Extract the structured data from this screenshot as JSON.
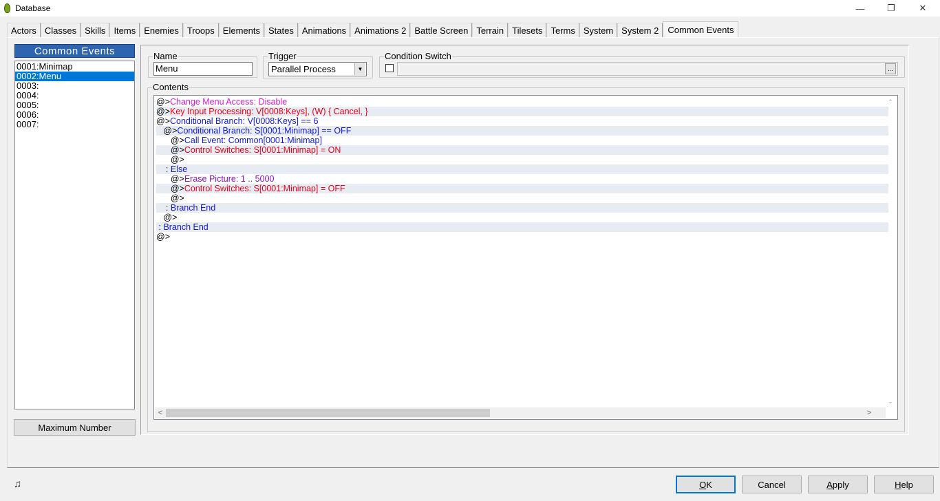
{
  "window": {
    "title": "Database",
    "icons": {
      "app": "egg-icon",
      "minimize": "minimize-icon",
      "restore": "restore-icon",
      "close": "close-icon"
    },
    "minimize_glyph": "—",
    "restore_glyph": "❐",
    "close_glyph": "✕"
  },
  "tabs": [
    {
      "label": "Actors"
    },
    {
      "label": "Classes"
    },
    {
      "label": "Skills"
    },
    {
      "label": "Items"
    },
    {
      "label": "Enemies"
    },
    {
      "label": "Troops"
    },
    {
      "label": "Elements"
    },
    {
      "label": "States"
    },
    {
      "label": "Animations"
    },
    {
      "label": "Animations 2"
    },
    {
      "label": "Battle Screen"
    },
    {
      "label": "Terrain"
    },
    {
      "label": "Tilesets"
    },
    {
      "label": "Terms"
    },
    {
      "label": "System"
    },
    {
      "label": "System 2"
    },
    {
      "label": "Common Events",
      "active": true
    }
  ],
  "sidebar": {
    "header": "Common Events",
    "items": [
      {
        "label": "0001:Minimap"
      },
      {
        "label": "0002:Menu",
        "selected": true
      },
      {
        "label": "0003:"
      },
      {
        "label": "0004:"
      },
      {
        "label": "0005:"
      },
      {
        "label": "0006:"
      },
      {
        "label": "0007:"
      }
    ],
    "max_button": "Maximum Number"
  },
  "form": {
    "name_label": "Name",
    "name_value": "Menu",
    "trigger_label": "Trigger",
    "trigger_value": "Parallel Process",
    "condition_label": "Condition Switch",
    "condition_checked": false,
    "condition_value": "",
    "condition_button": "...",
    "contents_label": "Contents"
  },
  "contents": [
    {
      "indent": "",
      "prefix": "@>",
      "text": "Change Menu Access: Disable",
      "color": "#d81bd8"
    },
    {
      "indent": "",
      "prefix": "@>",
      "text": "Key Input Processing: V[0008:Keys], (W) { Cancel, }",
      "color": "#e8001a"
    },
    {
      "indent": "",
      "prefix": "@>",
      "text": "Conditional Branch: V[0008:Keys] == 6",
      "color": "#1318e0"
    },
    {
      "indent": "   ",
      "prefix": "@>",
      "text": "Conditional Branch: S[0001:Minimap] == OFF",
      "color": "#1318e0"
    },
    {
      "indent": "      ",
      "prefix": "@>",
      "text": "Call Event: Common[0001:Minimap]",
      "color": "#1318e0"
    },
    {
      "indent": "      ",
      "prefix": "@>",
      "text": "Control Switches: S[0001:Minimap] = ON",
      "color": "#e8001a"
    },
    {
      "indent": "      ",
      "prefix": "@>",
      "text": "",
      "color": "#000000"
    },
    {
      "indent": "    ",
      "prefix": ": ",
      "text": "Else",
      "color": "#1318e0"
    },
    {
      "indent": "      ",
      "prefix": "@>",
      "text": "Erase Picture: 1 .. 5000",
      "color": "#8a0fb8"
    },
    {
      "indent": "      ",
      "prefix": "@>",
      "text": "Control Switches: S[0001:Minimap] = OFF",
      "color": "#e8001a"
    },
    {
      "indent": "      ",
      "prefix": "@>",
      "text": "",
      "color": "#000000"
    },
    {
      "indent": "    ",
      "prefix": ": ",
      "text": "Branch End",
      "color": "#1318e0"
    },
    {
      "indent": "   ",
      "prefix": "@>",
      "text": "",
      "color": "#000000"
    },
    {
      "indent": " ",
      "prefix": ": ",
      "text": "Branch End",
      "color": "#1318e0"
    },
    {
      "indent": "",
      "prefix": "@>",
      "text": "",
      "color": "#000000"
    }
  ],
  "scroll": {
    "left_arrow": "<",
    "right_arrow": ">",
    "up_arrow": "⌃",
    "down_arrow": "⌄"
  },
  "footer": {
    "music_icon": "music-note-icon",
    "music_glyph": "♫",
    "ok": "OK",
    "cancel": "Cancel",
    "apply": "Apply",
    "help": "Help"
  },
  "colors": {
    "list_header_bg": "#2f64b1",
    "selection_bg": "#0078d7",
    "alt_row": "#e6ecf2"
  }
}
